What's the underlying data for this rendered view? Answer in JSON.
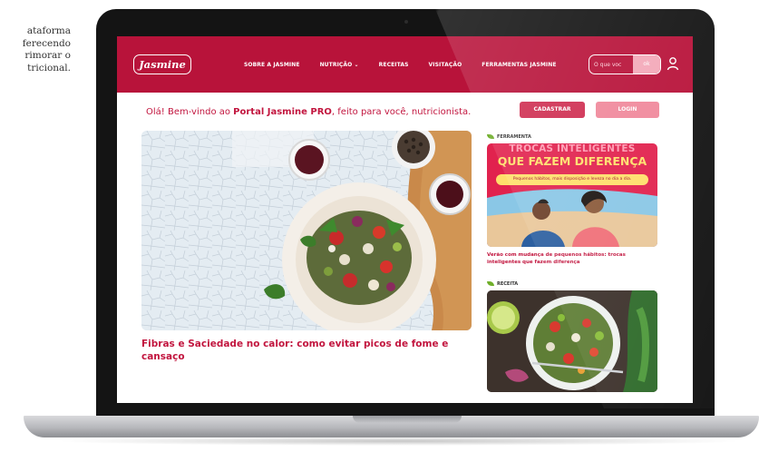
{
  "side_text": [
    "ataforma",
    "ferecendo",
    "rimorar o",
    "tricional."
  ],
  "header": {
    "logo": "Jasmine",
    "nav": [
      "SOBRE A JASMINE",
      "NUTRIÇÃO ⌄",
      "RECEITAS",
      "VISITAÇÃO",
      "FERRAMENTAS JASMINE"
    ],
    "search_placeholder": "O que voc",
    "search_button": "ok"
  },
  "welcome": {
    "prefix": "Olá! Bem-vindo ao ",
    "portal": "Portal Jasmine PRO",
    "suffix": ", feito para você, nutricionista."
  },
  "buttons": {
    "register": "CADASTRAR",
    "login": "LOGIN"
  },
  "hero": {
    "title": "Fibras e Saciedade no calor: como evitar picos de fome e cansaço"
  },
  "cards": [
    {
      "tag": "FERRAMENTA",
      "overline": "TROCAS INTELIGENTES",
      "headline": "QUE FAZEM DIFERENÇA",
      "pill": "Pequenos hábitos, mais disposição e leveza no dia a dia.",
      "caption": "Verão com mudança de pequenos hábitos: trocas inteligentes que fazem diferença"
    },
    {
      "tag": "RECEITA"
    }
  ],
  "colors": {
    "brand": "#b8133a",
    "accent": "#c2163f",
    "yellow": "#ffdf6b"
  }
}
